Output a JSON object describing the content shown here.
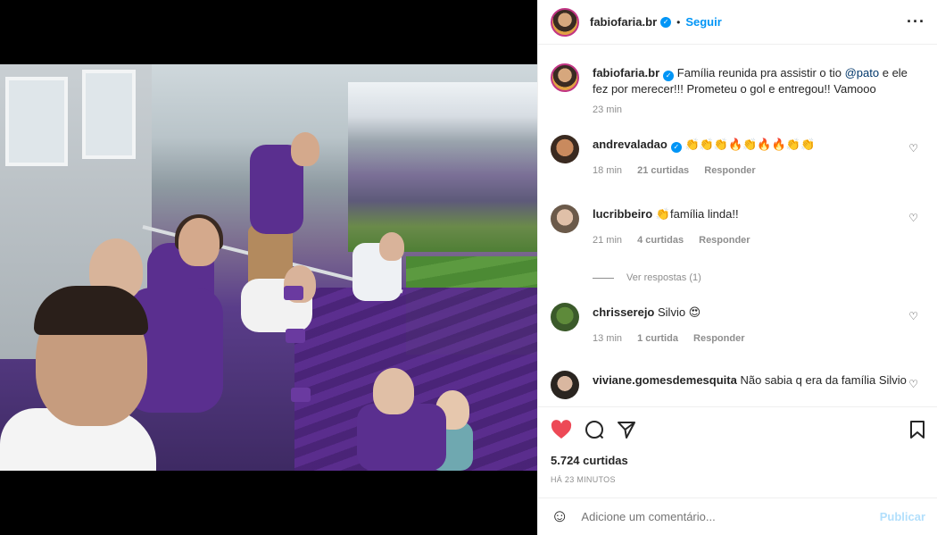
{
  "post": {
    "author": "fabiofaria.br",
    "follow_label": "Seguir",
    "more_icon": "more-icon"
  },
  "caption": {
    "author": "fabiofaria.br",
    "text_before": "Família reunida pra assistir o tio ",
    "mention": "@pato",
    "text_after": " e ele fez por merecer!!! Prometeu o gol e entregou!! Vamooo",
    "time": "23 min"
  },
  "comments": [
    {
      "user": "andrevaladao",
      "text": "👏👏👏🔥👏🔥🔥👏👏",
      "time": "18 min",
      "likes": "21 curtidas",
      "reply": "Responder"
    },
    {
      "user": "lucribbeiro",
      "text": "👏família linda!!",
      "time": "21 min",
      "likes": "4 curtidas",
      "reply": "Responder"
    },
    {
      "user": "chrisserejo",
      "text": "Silvio 😍",
      "time": "13 min",
      "likes": "1 curtida",
      "reply": "Responder"
    },
    {
      "user": "viviane.gomesdemesquita",
      "text": "Não sabia q era da família Silvio",
      "time": "",
      "likes": "",
      "reply": ""
    }
  ],
  "view_replies": "Ver respostas (1)",
  "likes_count": "5.724 curtidas",
  "posted_ago": "HÁ 23 MINUTOS",
  "comment_box": {
    "placeholder": "Adicione um comentário...",
    "publish_label": "Publicar"
  },
  "colors": {
    "accent": "#0095f6",
    "liked": "#ed4956",
    "muted": "#8e8e8e"
  }
}
